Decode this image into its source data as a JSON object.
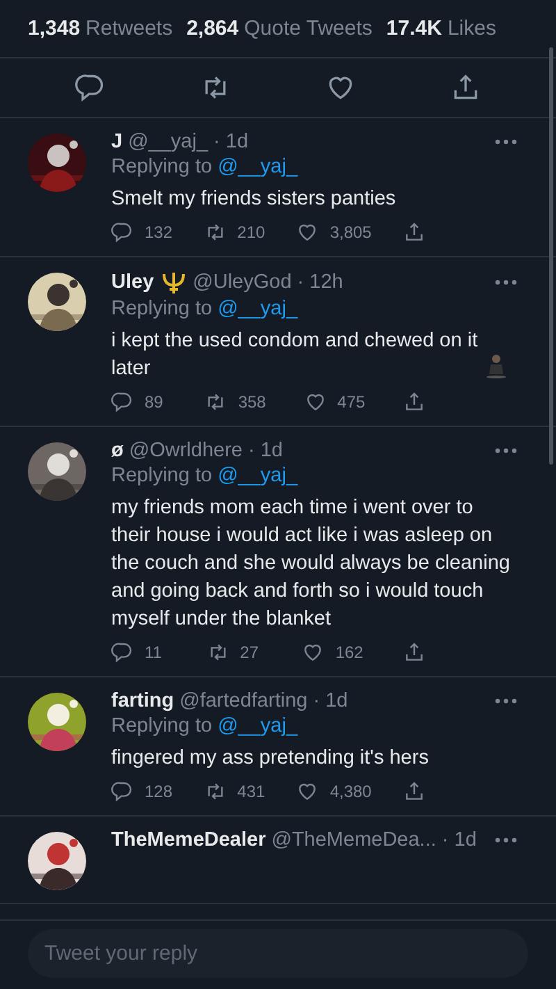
{
  "stats": [
    {
      "count": "1,348",
      "label": "Retweets"
    },
    {
      "count": "2,864",
      "label": "Quote Tweets"
    },
    {
      "count": "17.4K",
      "label": "Likes"
    }
  ],
  "replies": [
    {
      "name": "J",
      "trident_badge": false,
      "handle": "@__yaj_",
      "separator": "·",
      "time": "1d",
      "trailing_emoji": false,
      "replying_label": "Replying to",
      "replying_to": "@__yaj_",
      "text": "Smelt my friends sisters panties",
      "replies": "132",
      "retweets": "210",
      "likes": "3,805"
    },
    {
      "name": "Uley",
      "trident_badge": true,
      "handle": "@UleyGod",
      "separator": "·",
      "time": "12h",
      "trailing_emoji": true,
      "replying_label": "Replying to",
      "replying_to": "@__yaj_",
      "text": "i kept the used condom and chewed on it later",
      "replies": "89",
      "retweets": "358",
      "likes": "475"
    },
    {
      "name": "ø",
      "trident_badge": false,
      "handle": "@Owrldhere",
      "separator": "·",
      "time": "1d",
      "trailing_emoji": false,
      "replying_label": "Replying to",
      "replying_to": "@__yaj_",
      "text": "my friends mom each time i went over to their house i would act like i was asleep on the couch and she would always be cleaning and going back and forth so i would touch myself under the blanket",
      "replies": "11",
      "retweets": "27",
      "likes": "162"
    },
    {
      "name": "farting",
      "trident_badge": false,
      "handle": "@fartedfarting",
      "separator": "·",
      "time": "1d",
      "trailing_emoji": false,
      "replying_label": "Replying to",
      "replying_to": "@__yaj_",
      "text": "fingered my ass pretending it's hers",
      "replies": "128",
      "retweets": "431",
      "likes": "4,380"
    },
    {
      "name": "TheMemeDealer",
      "trident_badge": false,
      "handle": "@TheMemeDea...",
      "separator": "·",
      "time": "1d"
    }
  ],
  "reply_box": {
    "placeholder": "Tweet your reply"
  }
}
